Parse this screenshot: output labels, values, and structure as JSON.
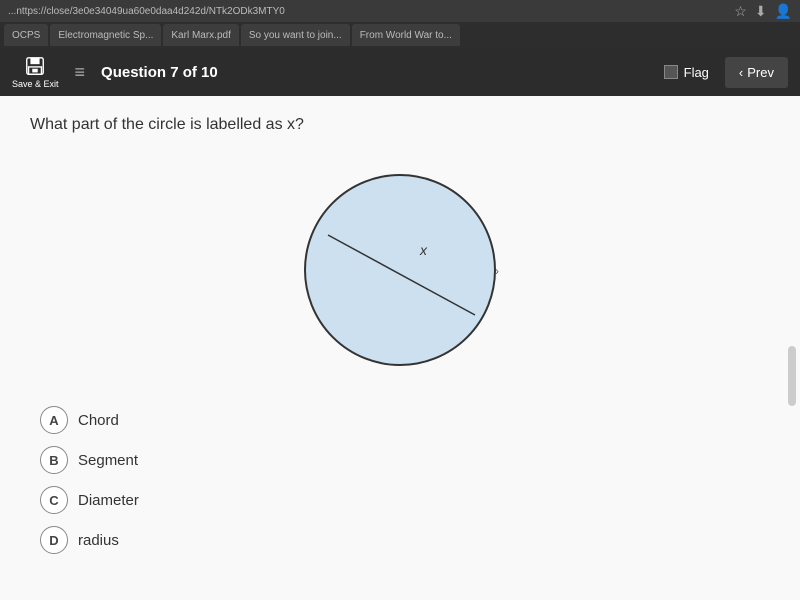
{
  "browser": {
    "tabs": [
      {
        "label": "OCPS",
        "active": false
      },
      {
        "label": "Electromagnetic Sp...",
        "active": false
      },
      {
        "label": "Karl Marx.pdf",
        "active": false
      },
      {
        "label": "So you want to join...",
        "active": false
      },
      {
        "label": "From World War to...",
        "active": false
      }
    ]
  },
  "toolbar": {
    "save_exit_label": "Save & Exit",
    "question_label": "Question 7 of 10",
    "flag_label": "Flag",
    "prev_label": "Prev"
  },
  "question": {
    "text": "What part of the circle is labelled as x?",
    "diagram_label": "x"
  },
  "options": [
    {
      "letter": "A",
      "text": "Chord"
    },
    {
      "letter": "B",
      "text": "Segment"
    },
    {
      "letter": "C",
      "text": "Diameter"
    },
    {
      "letter": "D",
      "text": "radius"
    }
  ]
}
